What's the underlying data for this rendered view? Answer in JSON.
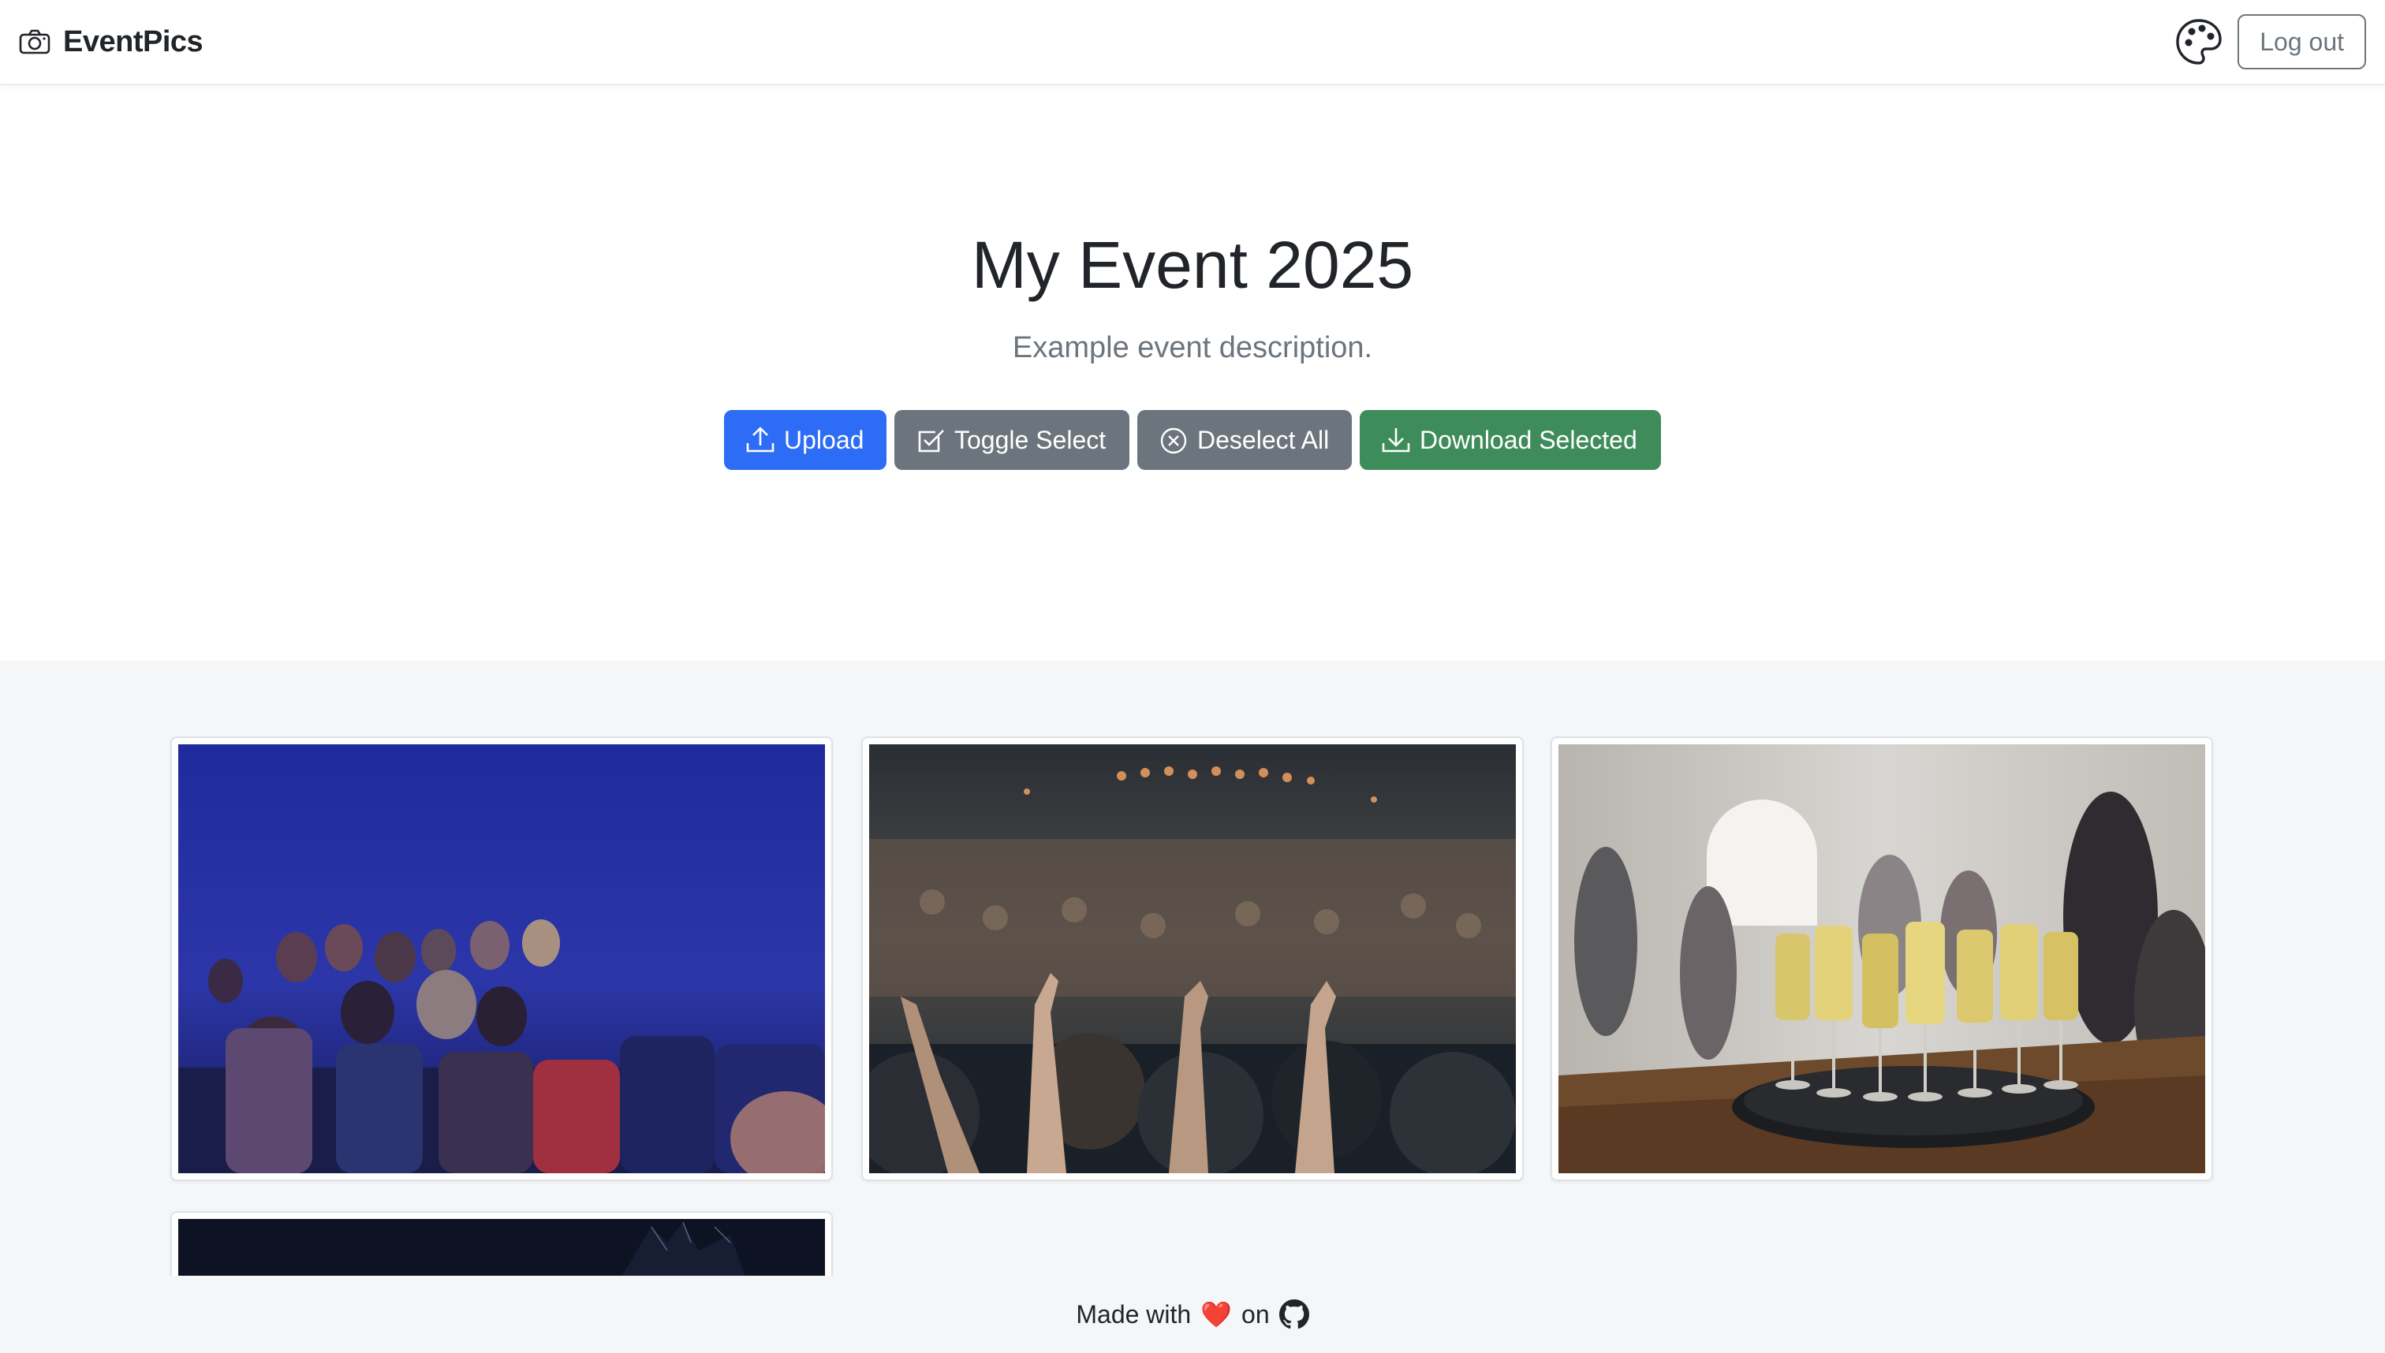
{
  "navbar": {
    "brand_icon": "camera-icon",
    "brand": "EventPics",
    "theme_icon": "palette-icon",
    "logout_label": "Log out"
  },
  "hero": {
    "title": "My Event 2025",
    "description": "Example event description."
  },
  "actions": [
    {
      "label": "Upload",
      "icon": "upload-icon",
      "color": "#2d6df6"
    },
    {
      "label": "Toggle Select",
      "icon": "check-square-icon",
      "color": "#6c757d"
    },
    {
      "label": "Deselect All",
      "icon": "x-circle-icon",
      "color": "#6c757d"
    },
    {
      "label": "Download Selected",
      "icon": "download-icon",
      "color": "#3f8c5b"
    }
  ],
  "gallery": {
    "photos": [
      {
        "subject": "audience-in-theater"
      },
      {
        "subject": "concert-crowd-hands-raised"
      },
      {
        "subject": "champagne-tray"
      },
      {
        "subject": "dark-stage"
      }
    ]
  },
  "footer": {
    "made_with": "Made with",
    "heart": "❤️",
    "on": "on",
    "github_icon": "github-icon"
  }
}
